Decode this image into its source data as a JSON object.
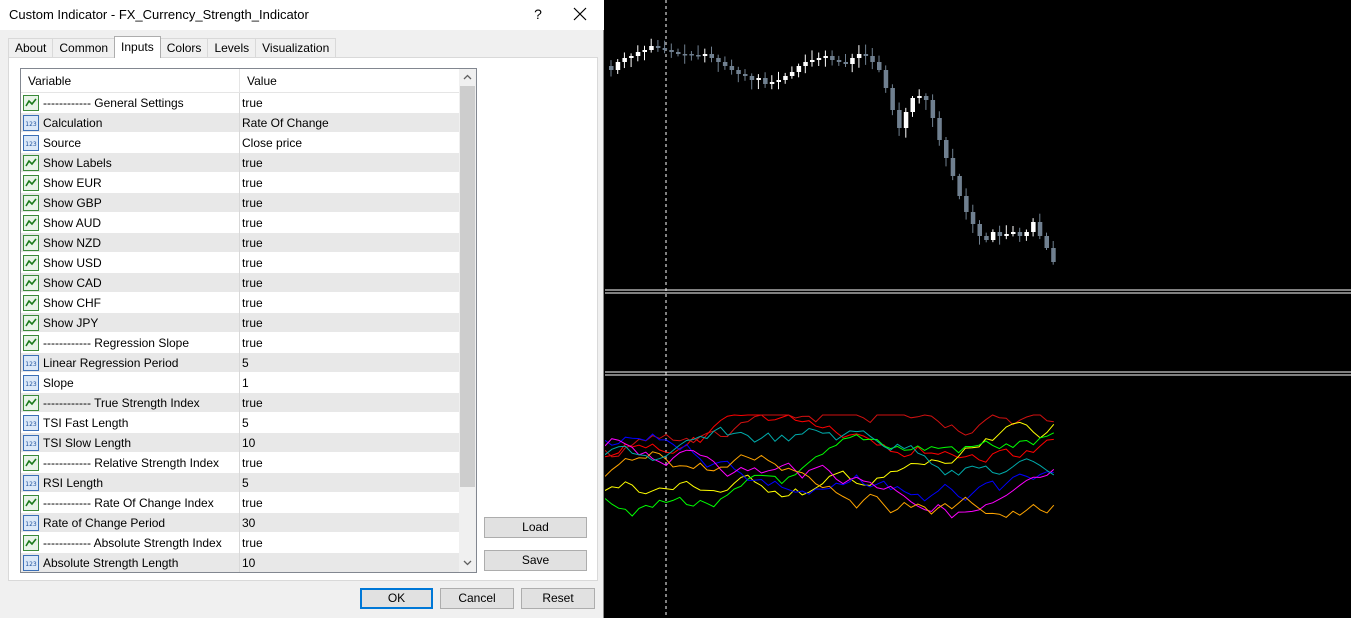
{
  "window": {
    "title": "Custom Indicator - FX_Currency_Strength_Indicator",
    "help_label": "?"
  },
  "tabs": [
    {
      "label": "About"
    },
    {
      "label": "Common"
    },
    {
      "label": "Inputs"
    },
    {
      "label": "Colors"
    },
    {
      "label": "Levels"
    },
    {
      "label": "Visualization"
    }
  ],
  "active_tab": "Inputs",
  "grid": {
    "col_variable": "Variable",
    "col_value": "Value",
    "rows": [
      {
        "icon": "bool-icon",
        "variable": "------------ General Settings",
        "value": "true"
      },
      {
        "icon": "number-icon",
        "variable": "Calculation",
        "value": "Rate Of Change"
      },
      {
        "icon": "number-icon",
        "variable": "Source",
        "value": "Close price"
      },
      {
        "icon": "bool-icon",
        "variable": "Show Labels",
        "value": "true"
      },
      {
        "icon": "bool-icon",
        "variable": "Show EUR",
        "value": "true"
      },
      {
        "icon": "bool-icon",
        "variable": "Show GBP",
        "value": "true"
      },
      {
        "icon": "bool-icon",
        "variable": "Show AUD",
        "value": "true"
      },
      {
        "icon": "bool-icon",
        "variable": "Show NZD",
        "value": "true"
      },
      {
        "icon": "bool-icon",
        "variable": "Show USD",
        "value": "true"
      },
      {
        "icon": "bool-icon",
        "variable": "Show CAD",
        "value": "true"
      },
      {
        "icon": "bool-icon",
        "variable": "Show CHF",
        "value": "true"
      },
      {
        "icon": "bool-icon",
        "variable": "Show JPY",
        "value": "true"
      },
      {
        "icon": "bool-icon",
        "variable": "------------ Regression Slope",
        "value": "true"
      },
      {
        "icon": "number-icon",
        "variable": "Linear Regression Period",
        "value": "5"
      },
      {
        "icon": "number-icon",
        "variable": "Slope",
        "value": "1"
      },
      {
        "icon": "bool-icon",
        "variable": "------------ True Strength Index",
        "value": "true"
      },
      {
        "icon": "number-icon",
        "variable": "TSI Fast Length",
        "value": "5"
      },
      {
        "icon": "number-icon",
        "variable": "TSI Slow Length",
        "value": "10"
      },
      {
        "icon": "bool-icon",
        "variable": "------------ Relative Strength Index",
        "value": "true"
      },
      {
        "icon": "number-icon",
        "variable": "RSI Length",
        "value": "5"
      },
      {
        "icon": "bool-icon",
        "variable": "------------ Rate Of Change Index",
        "value": "true"
      },
      {
        "icon": "number-icon",
        "variable": "Rate of Change Period",
        "value": "30"
      },
      {
        "icon": "bool-icon",
        "variable": "------------ Absolute Strength Index",
        "value": "true"
      },
      {
        "icon": "number-icon",
        "variable": "Absolute Strength Length",
        "value": "10"
      }
    ]
  },
  "buttons": {
    "load": "Load",
    "save": "Save",
    "ok": "OK",
    "cancel": "Cancel",
    "reset": "Reset"
  },
  "chart_data": {
    "type": "line",
    "colors": {
      "background": "#000000",
      "bull_candle": "#ffffff",
      "bear_candle": "#708090",
      "separator": "#ffffff",
      "crosshair": "#ffffff"
    },
    "series_colors": [
      "#ff0000",
      "#d01010",
      "#ffff00",
      "#00ff00",
      "#0000ff",
      "#ff00ff",
      "#ffa500",
      "#00aaaa"
    ]
  }
}
